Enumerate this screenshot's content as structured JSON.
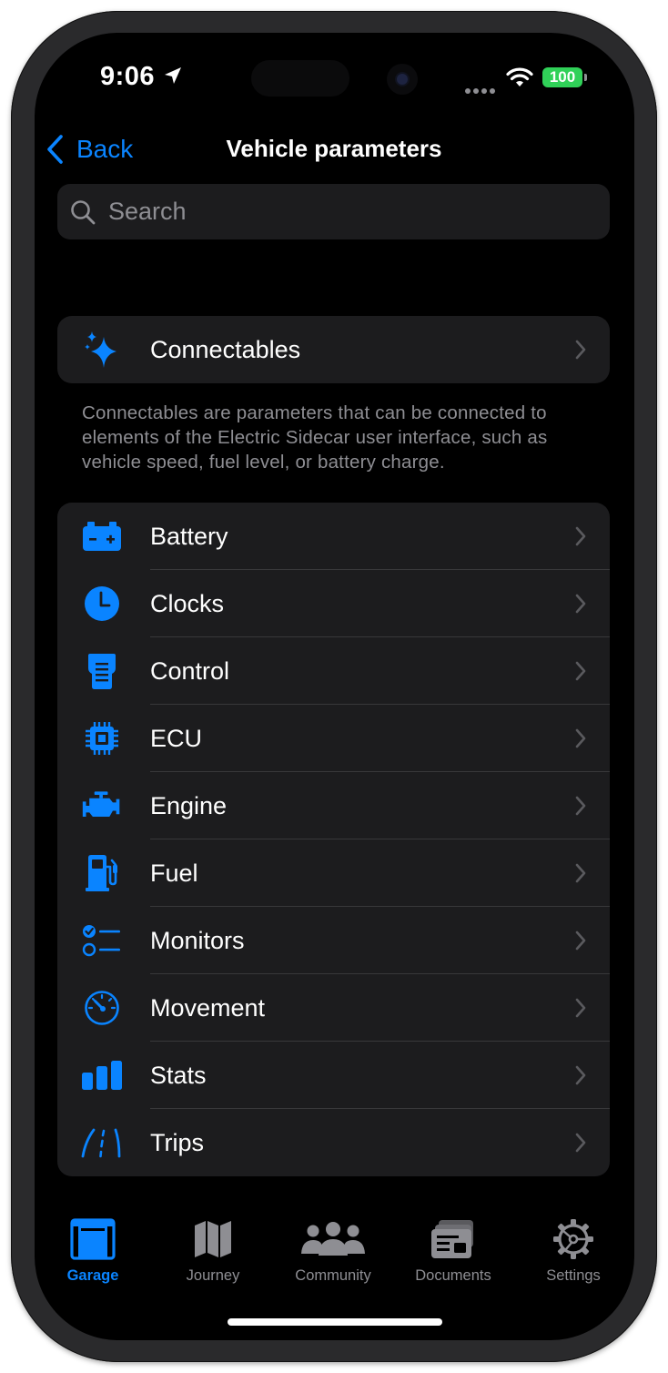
{
  "status_bar": {
    "time": "9:06",
    "battery": "100"
  },
  "nav": {
    "back_label": "Back",
    "title": "Vehicle parameters"
  },
  "search": {
    "placeholder": "Search"
  },
  "connectables": {
    "label": "Connectables",
    "icon": "sparkles-icon",
    "footer": "Connectables are parameters that can be connected to elements of the Electric Sidecar user interface, such as vehicle speed, fuel level, or battery charge."
  },
  "categories": [
    {
      "label": "Battery",
      "icon": "car-battery-icon"
    },
    {
      "label": "Clocks",
      "icon": "clock-icon"
    },
    {
      "label": "Control",
      "icon": "control-panel-icon"
    },
    {
      "label": "ECU",
      "icon": "cpu-chip-icon"
    },
    {
      "label": "Engine",
      "icon": "engine-icon"
    },
    {
      "label": "Fuel",
      "icon": "fuel-pump-icon"
    },
    {
      "label": "Monitors",
      "icon": "checklist-icon"
    },
    {
      "label": "Movement",
      "icon": "speedometer-icon"
    },
    {
      "label": "Stats",
      "icon": "bar-chart-icon"
    },
    {
      "label": "Trips",
      "icon": "road-lanes-icon"
    }
  ],
  "tab_bar": [
    {
      "label": "Garage",
      "icon": "garage-icon",
      "active": true
    },
    {
      "label": "Journey",
      "icon": "map-icon",
      "active": false
    },
    {
      "label": "Community",
      "icon": "people-icon",
      "active": false
    },
    {
      "label": "Documents",
      "icon": "documents-icon",
      "active": false
    },
    {
      "label": "Settings",
      "icon": "gear-icon",
      "active": false
    }
  ],
  "colors": {
    "accent": "#0a84ff",
    "background": "#000000",
    "cell": "#1c1c1e",
    "secondary_text": "#8e8e93",
    "battery_green": "#30d158"
  }
}
